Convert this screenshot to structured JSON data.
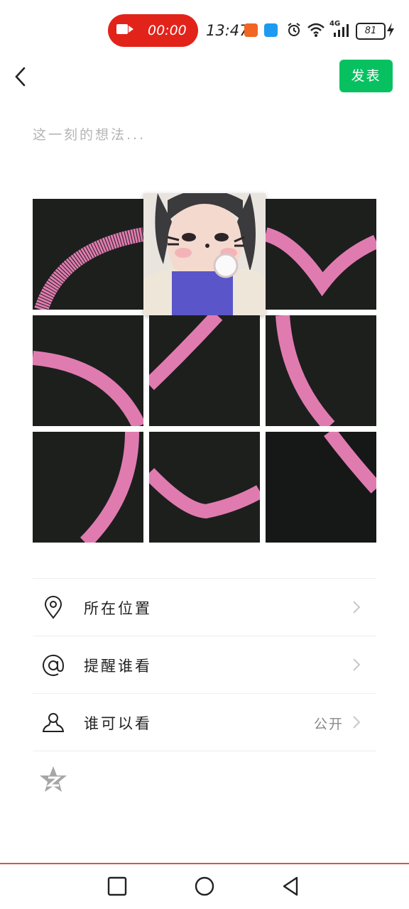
{
  "status_bar": {
    "record_time": "00:00",
    "clock": "13:47",
    "network": "4G",
    "battery": "81",
    "colors": {
      "record": "#e2231a"
    },
    "icons": [
      "video-camera-icon",
      "app-notification-icon",
      "cloud-icon",
      "alarm-icon",
      "wifi-icon",
      "signal-icon",
      "battery-icon",
      "charging-icon"
    ]
  },
  "header": {
    "publish_label": "发表",
    "accent_color": "#07c160"
  },
  "composer": {
    "placeholder": "这一刻的想法..."
  },
  "options": {
    "location_label": "所在位置",
    "mention_label": "提醒谁看",
    "visibility_label": "谁可以看",
    "visibility_value": "公开"
  },
  "nav": {
    "icons": [
      "square-recents-icon",
      "circle-home-icon",
      "triangle-back-icon"
    ]
  }
}
